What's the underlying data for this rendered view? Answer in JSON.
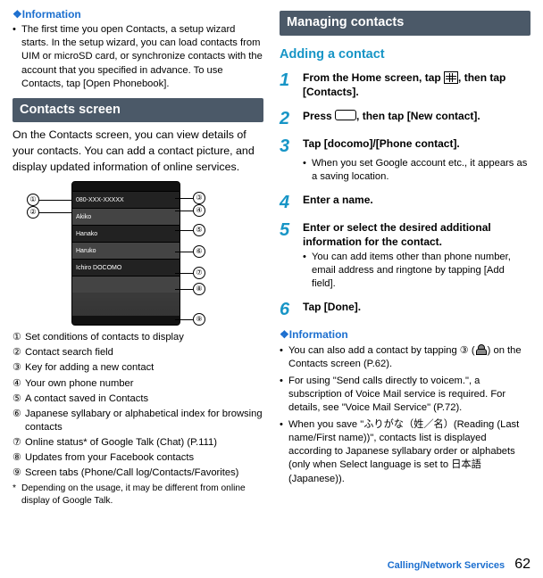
{
  "left": {
    "info_head": "❖Information",
    "info_bullet": "The first time you open Contacts, a setup wizard starts. In the setup wizard, you can load contacts from UIM or microSD card, or synchronize contacts with the account that you specified in advance. To use Contacts, tap [Open Phonebook].",
    "section": "Contacts screen",
    "intro": "On the Contacts screen, you can view details of your contacts. You can add a contact picture, and display updated information of online services.",
    "defs": [
      "Set conditions of contacts to display",
      "Contact search field",
      "Key for adding a new contact",
      "Your own phone number",
      "A contact saved in Contacts",
      "Japanese syllabary or alphabetical index for browsing contacts",
      "Online status* of Google Talk (Chat) (P.111)",
      "Updates from your Facebook contacts",
      "Screen tabs (Phone/Call log/Contacts/Favorites)"
    ],
    "note": "Depending on the usage, it may be different from online display of Google Talk.",
    "phone_rows": [
      "",
      "080-XXX-XXXXX",
      "Akiko",
      "Hanako",
      "Haruko",
      "Ichiro DOCOMO",
      ""
    ]
  },
  "right": {
    "section": "Managing contacts",
    "subhead": "Adding a contact",
    "steps": [
      {
        "title_a": "From the Home screen, tap ",
        "title_b": ", then tap [Contacts].",
        "icon": "grid"
      },
      {
        "title_a": "Press ",
        "title_b": ", then tap [New contact].",
        "icon": "menu"
      },
      {
        "title": "Tap [docomo]/[Phone contact].",
        "sub": "When you set Google account etc., it appears as a saving location."
      },
      {
        "title": "Enter a name."
      },
      {
        "title": "Enter or select the desired additional information for the contact.",
        "sub": "You can add items other than phone number, email address and ringtone by tapping [Add field]."
      },
      {
        "title": "Tap [Done]."
      }
    ],
    "info_head": "❖Information",
    "info_bullets": [
      {
        "a": "You can also add a contact by tapping ③ (",
        "b": ") on the Contacts screen (P.62).",
        "icon": "person"
      },
      {
        "t": "For using \"Send calls directly to voicem.\", a subscription of Voice Mail service is required. For details, see \"Voice Mail Service\" (P.72)."
      },
      {
        "t": "When you save \"ふりがな（姓／名）(Reading (Last name/First name))\", contacts list is displayed according to Japanese syllabary order or alphabets (only when Select language is set to 日本語 (Japanese))."
      }
    ]
  },
  "footer": {
    "label": "Calling/Network Services",
    "page": "62"
  },
  "circled": [
    "①",
    "②",
    "③",
    "④",
    "⑤",
    "⑥",
    "⑦",
    "⑧",
    "⑨"
  ]
}
